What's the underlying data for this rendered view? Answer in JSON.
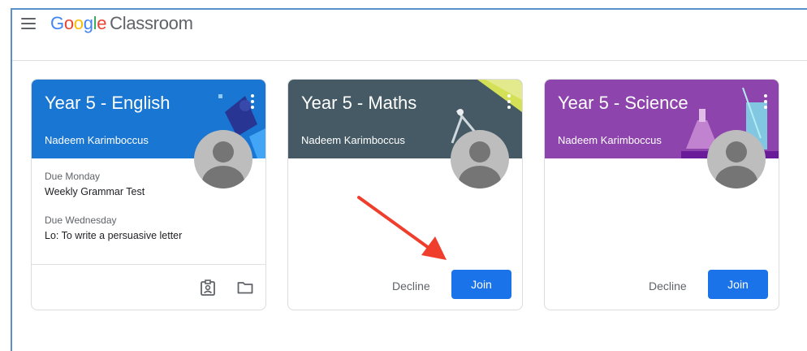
{
  "header": {
    "logo_google_letters": [
      "G",
      "o",
      "o",
      "g",
      "l",
      "e"
    ],
    "logo_product": "Classroom"
  },
  "cards": [
    {
      "title": "Year 5 - English",
      "teacher": "Nadeem Karimboccus",
      "color": "#1976d2",
      "assignments": [
        {
          "due": "Due Monday",
          "task": "Weekly Grammar Test"
        },
        {
          "due": "Due Wednesday",
          "task": "Lo: To write a persuasive letter"
        }
      ],
      "footer_icons": [
        "assignments-icon",
        "folder-icon"
      ]
    },
    {
      "title": "Year 5 - Maths",
      "teacher": "Nadeem Karimboccus",
      "color": "#455a64",
      "decline_label": "Decline",
      "join_label": "Join"
    },
    {
      "title": "Year 5 - Science",
      "teacher": "Nadeem Karimboccus",
      "color": "#8e44ad",
      "decline_label": "Decline",
      "join_label": "Join"
    }
  ],
  "annotation": {
    "arrow_color": "#f03e2c",
    "points_to": "Join"
  }
}
